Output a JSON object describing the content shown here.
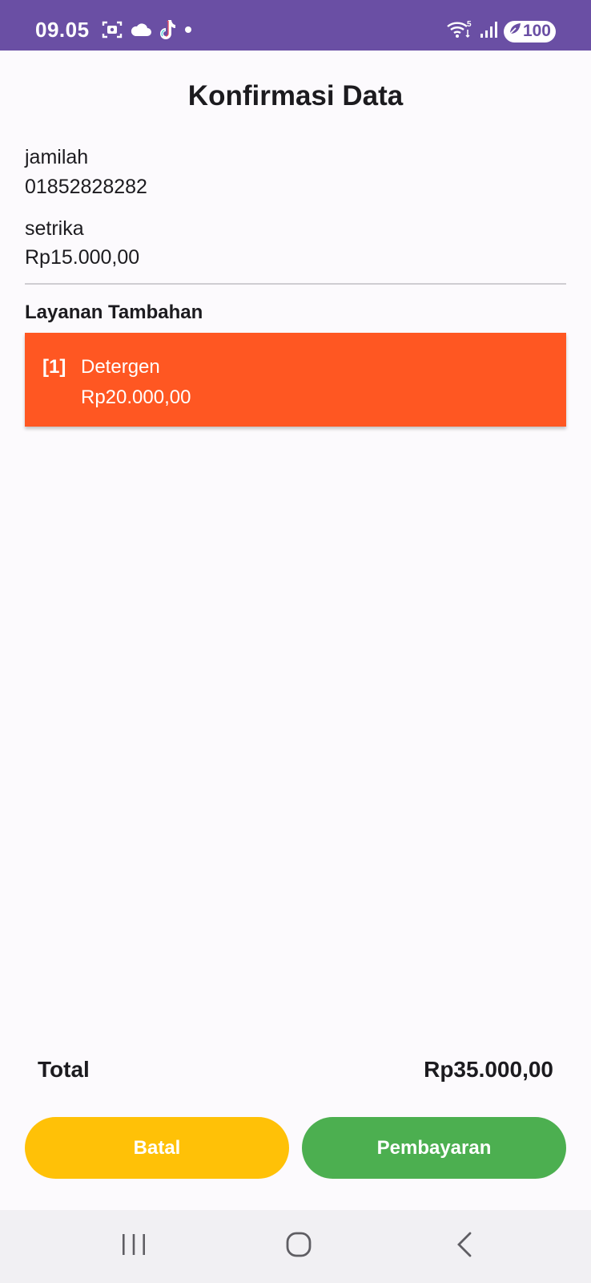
{
  "status_bar": {
    "time": "09.05",
    "battery": "100",
    "network": "5",
    "colors": {
      "background": "#6a4fa4",
      "foreground": "#ffffff"
    },
    "icons": [
      "screenshot-icon",
      "cloud-icon",
      "tiktok-icon",
      "dot-icon",
      "wifi-icon",
      "signal-icon",
      "battery-saver-icon"
    ]
  },
  "page": {
    "title": "Konfirmasi Data"
  },
  "customer": {
    "name": "jamilah",
    "phone": "01852828282"
  },
  "service": {
    "name": "setrika",
    "price": "Rp15.000,00"
  },
  "additional": {
    "section_title": "Layanan Tambahan",
    "items": [
      {
        "index": "[1]",
        "name": "Detergen",
        "price": "Rp20.000,00"
      }
    ],
    "card_color": "#ff5722"
  },
  "total": {
    "label": "Total",
    "value": "Rp35.000,00"
  },
  "actions": {
    "cancel_label": "Batal",
    "cancel_color": "#ffc107",
    "pay_label": "Pembayaran",
    "pay_color": "#4caf50"
  },
  "nav_bar": {
    "icons": [
      "recents-icon",
      "home-icon",
      "back-icon"
    ]
  }
}
